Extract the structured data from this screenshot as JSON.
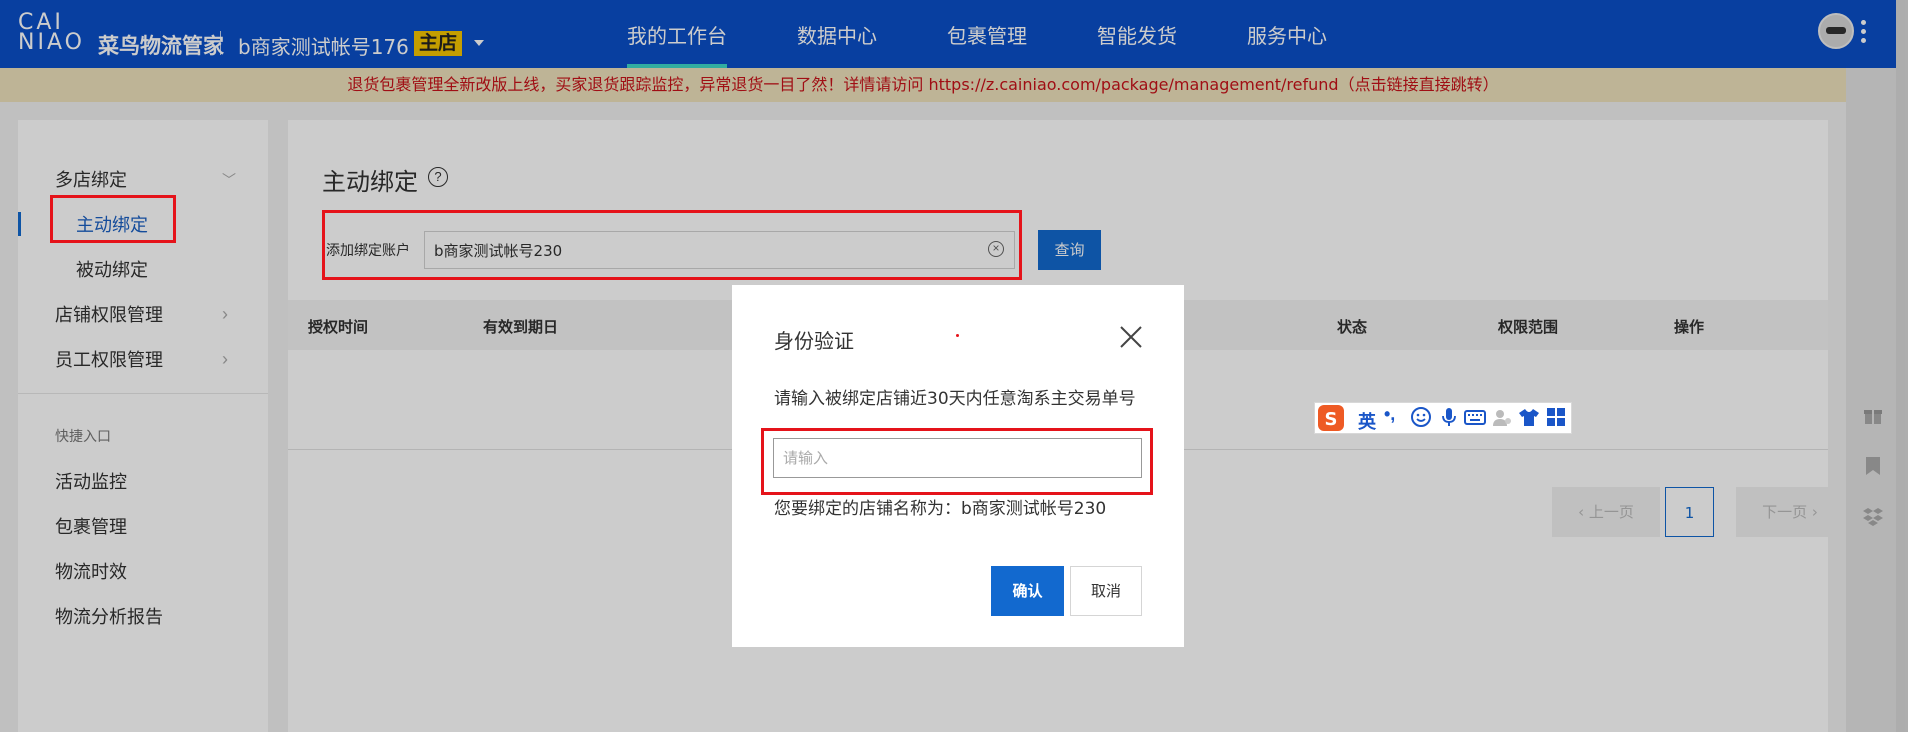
{
  "header": {
    "logo_line1": "CAI",
    "logo_line2": "NIAO",
    "brand_text": "菜鸟物流管家",
    "account_name": "b商家测试帐号176",
    "main_badge": "主店",
    "nav": [
      "我的工作台",
      "数据中心",
      "包裹管理",
      "智能发货",
      "服务中心"
    ],
    "active_nav_index": 0
  },
  "announcement": "退货包裹管理全新改版上线，买家退货跟踪监控，异常退货一目了然！详情请访问 https://z.cainiao.com/package/management/refund（点击链接直接跳转）",
  "sidebar": {
    "group_multi_shop": "多店绑定",
    "sub_active_bind": "主动绑定",
    "sub_passive_bind": "被动绑定",
    "shop_permission": "店铺权限管理",
    "staff_permission": "员工权限管理",
    "quick_entry_title": "快捷入口",
    "quick_links": [
      "活动监控",
      "包裹管理",
      "物流时效",
      "物流分析报告"
    ]
  },
  "main": {
    "page_title": "主动绑定",
    "bind_label": "添加绑定账户",
    "bind_input_value": "b商家测试帐号230",
    "query_button": "查询",
    "table_headers": [
      "授权时间",
      "有效到期日",
      "状态",
      "权限范围",
      "操作"
    ],
    "pagination": {
      "prev": "上一页",
      "current": "1",
      "next": "下一页"
    }
  },
  "modal": {
    "title": "身份验证",
    "prompt": "请输入被绑定店铺近30天内任意淘系主交易单号",
    "input_placeholder": "请输入",
    "shop_name_text": "您要绑定的店铺名称为：b商家测试帐号230",
    "confirm_button": "确认",
    "cancel_button": "取消"
  },
  "ime_toolbar": {
    "lang": "英",
    "icons": [
      "sogou-icon",
      "lang-icon",
      "punctuation-icon",
      "emoji-icon",
      "mic-icon",
      "keyboard-icon",
      "user-icon",
      "skin-icon",
      "grid-icon"
    ]
  },
  "colors": {
    "header_bg": "#0a4fc8",
    "accent": "#1269cf",
    "annotation": "#e5131a",
    "badge": "#f5c600",
    "announcement_bg": "#eee2bc"
  }
}
